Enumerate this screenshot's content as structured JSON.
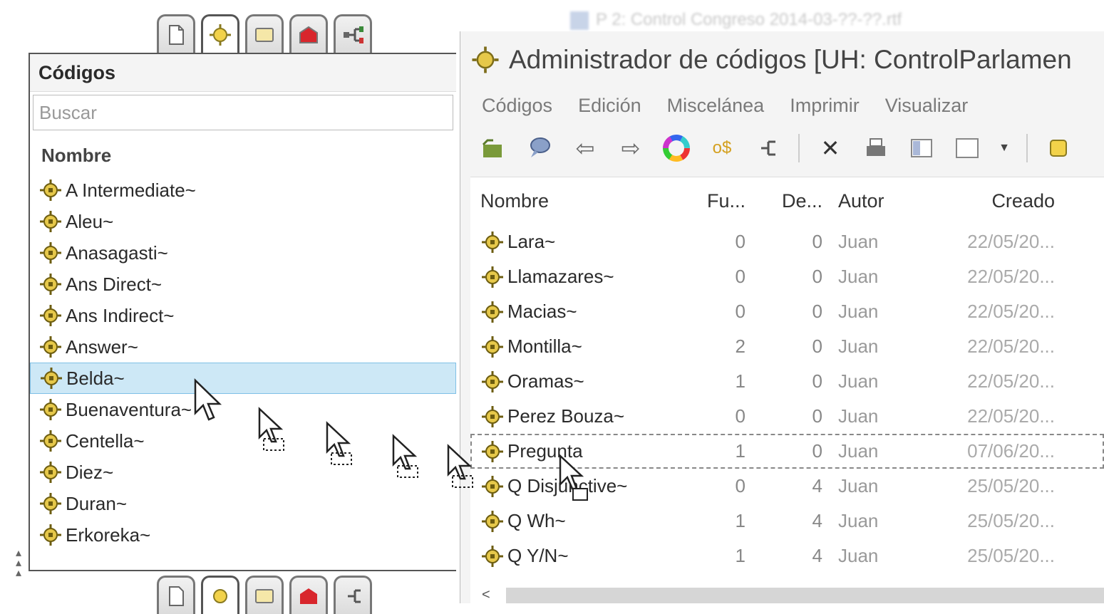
{
  "left_panel": {
    "title": "Códigos",
    "search_placeholder": "Buscar",
    "column_header": "Nombre",
    "items": [
      "A Intermediate~",
      "Aleu~",
      "Anasagasti~",
      "Ans Direct~",
      "Ans Indirect~",
      "Answer~",
      "Belda~",
      "Buenaventura~",
      "Centella~",
      "Diez~",
      "Duran~",
      "Erkoreka~"
    ],
    "selected_item": "Belda~"
  },
  "top_tabs": [
    "document-icon",
    "code-icon",
    "memo-icon",
    "case-icon",
    "network-icon"
  ],
  "bottom_tabs": [
    "document-icon",
    "code-icon",
    "memo-icon",
    "case-icon",
    "network-icon"
  ],
  "background_window_title": "P 2: Control Congreso 2014-03-??-??.rtf",
  "code_manager": {
    "title": "Administrador de códigos [UH: ControlParlamen",
    "menu": [
      "Códigos",
      "Edición",
      "Miscelánea",
      "Imprimir",
      "Visualizar"
    ],
    "toolbar": [
      "new-code-icon",
      "comment-icon",
      "back-icon",
      "forward-icon",
      "color-wheel-icon",
      "filter-icon",
      "network-icon",
      "delete-icon",
      "print-icon",
      "split-view-icon",
      "layout-icon",
      "dropdown-icon",
      "code-icon"
    ],
    "columns": [
      "Nombre",
      "Fu...",
      "De...",
      "Autor",
      "Creado"
    ],
    "rows": [
      {
        "name": "Lara~",
        "fu": "0",
        "de": "0",
        "autor": "Juan",
        "creado": "22/05/20..."
      },
      {
        "name": "Llamazares~",
        "fu": "0",
        "de": "0",
        "autor": "Juan",
        "creado": "22/05/20..."
      },
      {
        "name": "Macias~",
        "fu": "0",
        "de": "0",
        "autor": "Juan",
        "creado": "22/05/20..."
      },
      {
        "name": "Montilla~",
        "fu": "2",
        "de": "0",
        "autor": "Juan",
        "creado": "22/05/20..."
      },
      {
        "name": "Oramas~",
        "fu": "1",
        "de": "0",
        "autor": "Juan",
        "creado": "22/05/20..."
      },
      {
        "name": "Perez Bouza~",
        "fu": "0",
        "de": "0",
        "autor": "Juan",
        "creado": "22/05/20..."
      },
      {
        "name": "Pregunta",
        "fu": "1",
        "de": "0",
        "autor": "Juan",
        "creado": "07/06/20..."
      },
      {
        "name": "Q Disjunctive~",
        "fu": "0",
        "de": "4",
        "autor": "Juan",
        "creado": "25/05/20..."
      },
      {
        "name": "Q Wh~",
        "fu": "1",
        "de": "4",
        "autor": "Juan",
        "creado": "25/05/20..."
      },
      {
        "name": "Q Y/N~",
        "fu": "1",
        "de": "4",
        "autor": "Juan",
        "creado": "25/05/20..."
      }
    ],
    "drop_target_row": "Pregunta"
  },
  "colors": {
    "selection": "#cde8f6",
    "selection_border": "#7fc0e6",
    "code_yellow": "#e6c84a",
    "window_bg": "#f4f4f4"
  }
}
